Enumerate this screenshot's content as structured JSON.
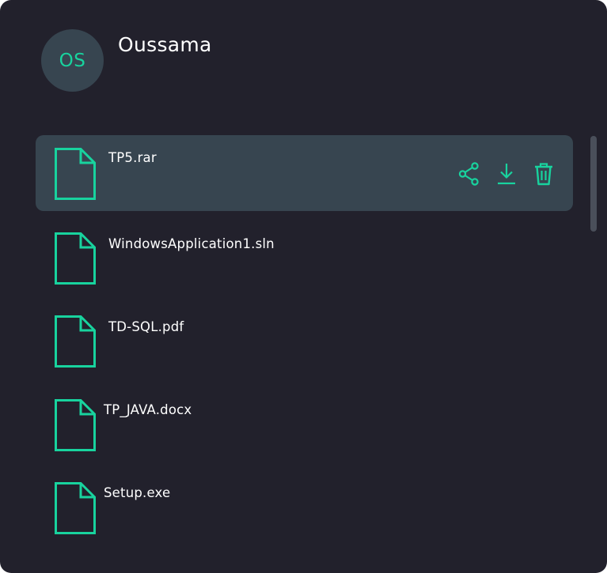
{
  "user": {
    "initials": "OS",
    "name": "Oussama"
  },
  "files": [
    {
      "name": "TP5.rar",
      "selected": true
    },
    {
      "name": "WindowsApplication1.sln",
      "selected": false
    },
    {
      "name": "TD-SQL.pdf",
      "selected": false
    },
    {
      "name": "TP_JAVA.docx",
      "selected": false
    },
    {
      "name": "Setup.exe",
      "selected": false
    }
  ],
  "actions": {
    "share_icon": "share-icon",
    "download_icon": "download-icon",
    "delete_icon": "trash-icon"
  },
  "colors": {
    "background": "#22212c",
    "selected_row": "#374550",
    "accent": "#18d39e",
    "text": "#ffffff"
  }
}
